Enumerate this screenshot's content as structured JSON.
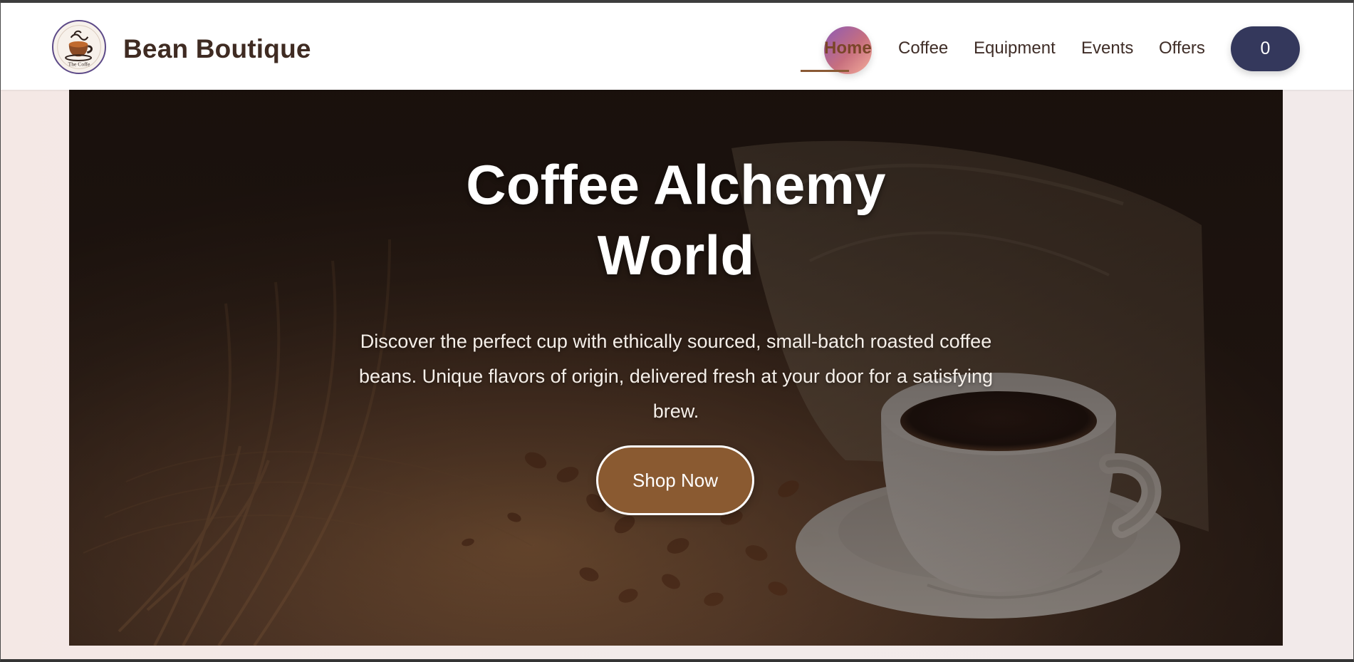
{
  "header": {
    "brand": {
      "name": "Bean Boutique",
      "logo_text": "The Coffe",
      "logo_icon": "coffee-cup-logo-icon"
    },
    "nav": {
      "items": [
        {
          "label": "Home",
          "active": true
        },
        {
          "label": "Coffee",
          "active": false
        },
        {
          "label": "Equipment",
          "active": false
        },
        {
          "label": "Events",
          "active": false
        },
        {
          "label": "Offers",
          "active": false
        }
      ]
    },
    "cart": {
      "count": "0"
    }
  },
  "hero": {
    "title": "Coffee Alchemy World",
    "description": "Discover the perfect cup with ethically sourced, small-batch roasted coffee beans. Unique flavors of origin, delivered fresh at your door for a satisfying brew.",
    "cta_label": "Shop Now",
    "image_subject": "coffee-beans-sack-and-cup"
  },
  "colors": {
    "header_background": "#ffffff",
    "brand_text": "#3f2b22",
    "active_nav": "#7a4528",
    "cart_button": "#34385c",
    "hero_button": "#8a5a31",
    "page_background": "#f4e9e6"
  }
}
